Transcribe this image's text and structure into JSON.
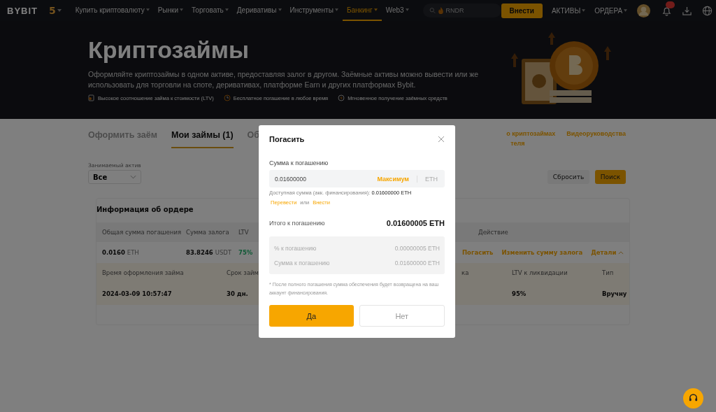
{
  "header": {
    "logo": "BYBIT",
    "badge": "5",
    "nav": [
      {
        "label": "Купить криптовалюту",
        "selected": false
      },
      {
        "label": "Рынки",
        "selected": false
      },
      {
        "label": "Торговать",
        "selected": false
      },
      {
        "label": "Деривативы",
        "selected": false
      },
      {
        "label": "Инструменты",
        "selected": false
      },
      {
        "label": "Банкинг",
        "selected": true
      },
      {
        "label": "Web3",
        "selected": false
      }
    ],
    "search": {
      "placeholder": "RNDR"
    },
    "deposit": "Внести",
    "menus": [
      "АКТИВЫ",
      "ОРДЕРА"
    ],
    "notifications": true
  },
  "hero": {
    "title": "Криптозаймы",
    "description": "Оформляйте криптозаймы в одном активе, предоставляя залог в другом. Заёмные активы можно вывести или же использовать для торговли на споте, деривативах, платформе Earn и других платформах Bybit.",
    "features": [
      {
        "kind": "ltv",
        "text": "Высокое соотношение займа к стоимости (LTV)"
      },
      {
        "kind": "clock",
        "text": "Бесплатное погашение в любое время"
      },
      {
        "kind": "bolt",
        "text": "Мгновенное получение заёмных средств"
      }
    ]
  },
  "tabs": [
    {
      "label": "Оформить заём",
      "selected": false
    },
    {
      "label": "Мои займы (1)",
      "selected": true
    },
    {
      "label": "Об",
      "selected": false
    }
  ],
  "links": [
    "о криптозаймах",
    "Видеоруководства",
    "теля"
  ],
  "filter": {
    "label": "Занимаемый актив",
    "value": "Все",
    "reset": "Сбросить",
    "search": "Поиск"
  },
  "order": {
    "title": "Информация об ордере",
    "columns": [
      "Общая сумма погашения",
      "Сумма залога",
      "LTV",
      "Действие"
    ],
    "row": {
      "repay": "0.0160",
      "repay_unit": "ETH",
      "collateral": "83.8246",
      "collateral_unit": "USDT",
      "ltv": "75%",
      "actions": [
        "Погасить",
        "Изменить сумму залога",
        "Детали"
      ]
    },
    "detail_columns": [
      "Время оформления займа",
      "Срок займ",
      "ка",
      "LTV к ликвидации",
      "Тип"
    ],
    "detail_values": [
      "2024-03-09 10:57:47",
      "30 дн.",
      "95%",
      "Вручну"
    ]
  },
  "modal": {
    "title": "Погасить",
    "amount_label": "Сумма к погашению",
    "amount_value": "0.01600000",
    "max": "Максимум",
    "unit": "ETH",
    "available": "Доступная сумма (акк. финансирования): **0.01600000 ETH**",
    "transfer": "Перевести",
    "or": "или",
    "deposit": "Внести",
    "total_label": "Итого к погашению",
    "total_value": "0.01600005 ETH",
    "breakdown": [
      {
        "label": "% к погашению",
        "value": "0.00000005 ETH"
      },
      {
        "label": "Сумма к погашению",
        "value": "0.01600000 ETH"
      }
    ],
    "note": "* После полного погашения сумма обеспечения будет возвращена на ваш аккаунт финансирования.",
    "yes": "Да",
    "no": "Нет"
  }
}
